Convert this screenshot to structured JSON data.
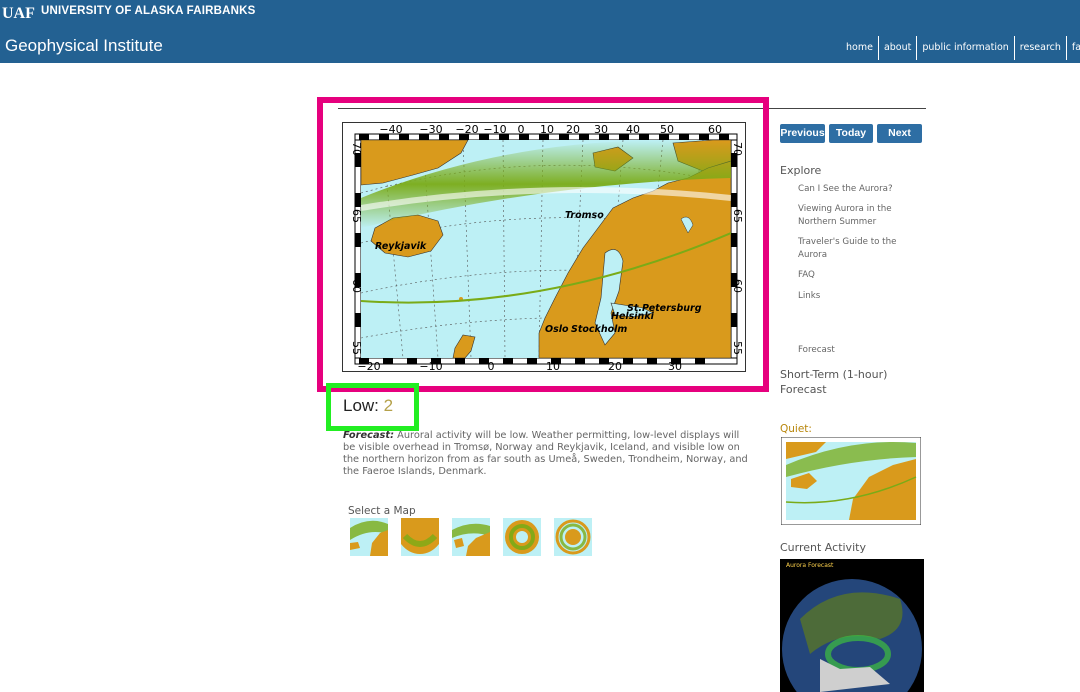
{
  "header": {
    "university": "UNIVERSITY OF ALASKA FAIRBANKS",
    "site_title": "Geophysical Institute",
    "nav": [
      "home",
      "about",
      "public information",
      "research",
      "facilit"
    ]
  },
  "map": {
    "top_ticks": [
      "−40",
      "−30",
      "−20",
      "−10",
      "0",
      "10",
      "20",
      "30",
      "40",
      "50",
      "60"
    ],
    "bottom_ticks": [
      "−20",
      "−10",
      "0",
      "10",
      "20",
      "30"
    ],
    "left_ticks": [
      "70",
      "65",
      "60",
      "55"
    ],
    "right_ticks": [
      "70",
      "65",
      "60",
      "55"
    ],
    "cities": [
      "Reykjavik",
      "Tromso",
      "St.Petersburg",
      "Helsinki",
      "Oslo",
      "Stockholm"
    ]
  },
  "activity": {
    "label": "Low:",
    "value": "2"
  },
  "forecast": {
    "label": "Forecast:",
    "text": " Auroral activity will be low. Weather permitting, low-level displays will be visible overhead in Tromsø, Norway and Reykjavik, Iceland, and visible low on the northern horizon from as far south as Umeå, Sweden, Trondheim, Norway, and the Faeroe Islands, Denmark."
  },
  "select_map_label": "Select a Map",
  "buttons": {
    "previous": "Previous",
    "today": "Today",
    "next": "Next"
  },
  "sidebar": {
    "explore": "Explore",
    "links": [
      "Can I See the Aurora?",
      "Viewing Aurora in the Northern Summer",
      "Traveler's Guide to the Aurora",
      "FAQ",
      "Links"
    ],
    "forecast_link": "Forecast",
    "short_term": "Short-Term (1-hour) Forecast",
    "quiet": "Quiet:",
    "current_activity": "Current Activity",
    "current_title": "Aurora Forecast"
  },
  "colors": {
    "header_bg": "#236192",
    "land": "#d99a1c",
    "ocean": "#bdf0f5",
    "aurora": "#7aab17",
    "highlight_pink": "#e6007e",
    "highlight_green": "#22ee22",
    "button": "#2e6ea4"
  },
  "icons": [
    "uaf-logo-icon"
  ]
}
